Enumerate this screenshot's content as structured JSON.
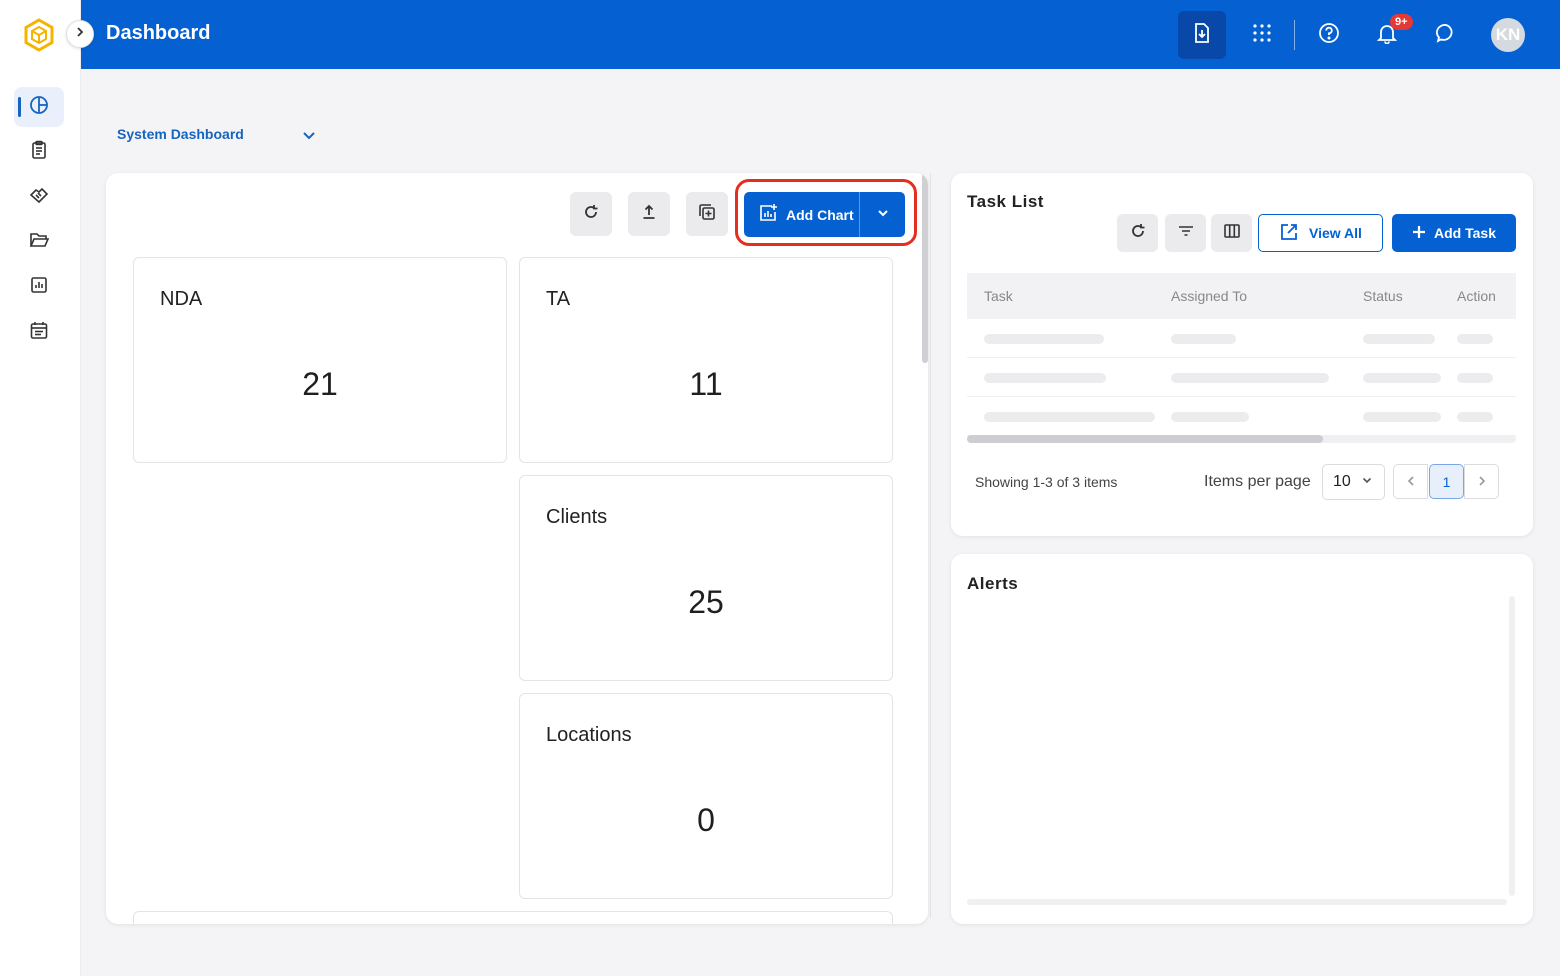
{
  "header": {
    "title": "Dashboard",
    "badge": "9+",
    "avatar": "KN"
  },
  "sidebar": {
    "items": [
      {
        "icon": "pie-chart-icon",
        "active": true
      },
      {
        "icon": "clipboard-icon"
      },
      {
        "icon": "handshake-icon"
      },
      {
        "icon": "folder-open-icon"
      },
      {
        "icon": "bar-chart-icon"
      },
      {
        "icon": "calendar-icon"
      }
    ]
  },
  "dashboard_select": {
    "value": "System Dashboard"
  },
  "toolbar": {
    "add_chart_label": "Add Chart"
  },
  "cards": [
    {
      "title": "NDA",
      "value": "21"
    },
    {
      "title": "TA",
      "value": "11"
    },
    {
      "title": "Clients",
      "value": "25"
    },
    {
      "title": "Locations",
      "value": "0"
    }
  ],
  "task_list": {
    "title": "Task List",
    "view_all_label": "View All",
    "add_task_label": "Add Task",
    "columns": [
      "Task",
      "Assigned To",
      "Status",
      "Action"
    ],
    "showing": "Showing 1-3 of 3 items",
    "items_per_page_label": "Items per page",
    "items_per_page_value": "10",
    "current_page": "1"
  },
  "alerts": {
    "title": "Alerts"
  },
  "colors": {
    "brand": "#0561d1",
    "highlight": "#e62e1e",
    "badge": "#e53935"
  }
}
